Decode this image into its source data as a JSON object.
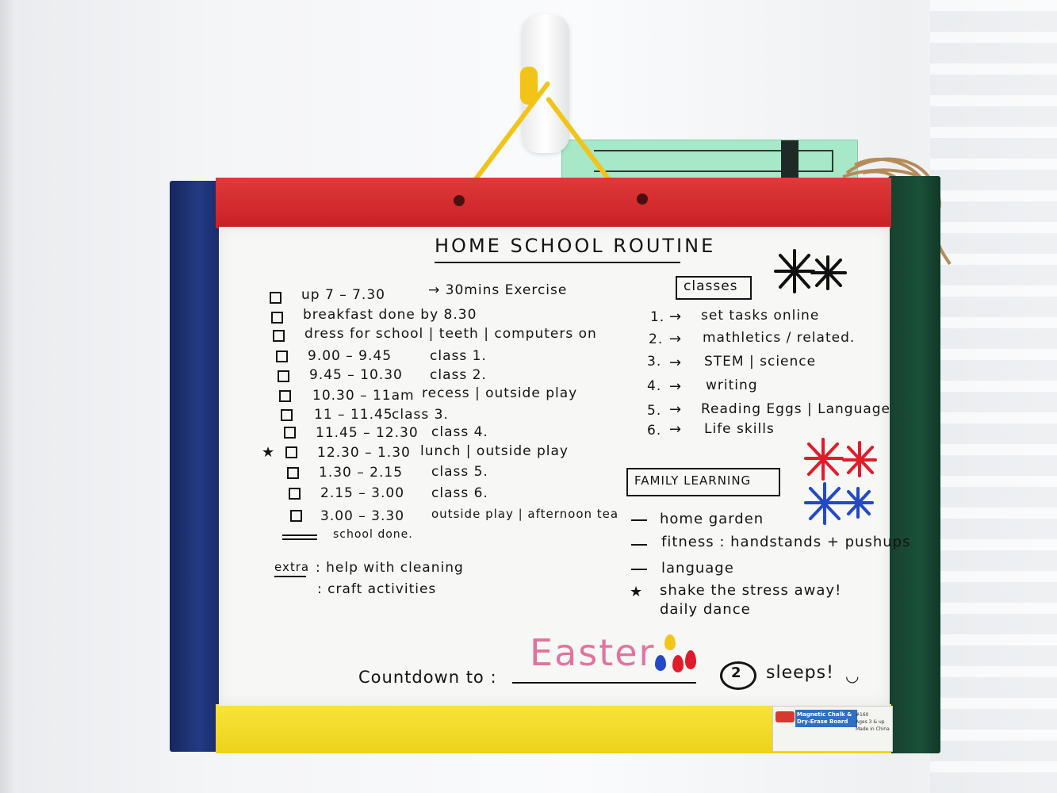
{
  "board": {
    "title": "HOME SCHOOL ROUTINE",
    "routine": [
      {
        "time": "up 7 – 7.30",
        "activity": "→ 30mins Exercise"
      },
      {
        "time": "breakfast done by 8.30",
        "activity": ""
      },
      {
        "time": "dress for school | teeth | computers on",
        "activity": ""
      },
      {
        "time": "9.00 – 9.45",
        "activity": "class 1."
      },
      {
        "time": "9.45 – 10.30",
        "activity": "class 2."
      },
      {
        "time": "10.30 – 11am",
        "activity": "recess | outside play"
      },
      {
        "time": "11 – 11.45",
        "activity": "class 3."
      },
      {
        "time": "11.45 – 12.30",
        "activity": "class 4."
      },
      {
        "time": "12.30 – 1.30",
        "activity": "lunch | outside play"
      },
      {
        "time": "1.30 – 2.15",
        "activity": "class 5."
      },
      {
        "time": "2.15 – 3.00",
        "activity": "class 6."
      },
      {
        "time": "3.00 – 3.30",
        "activity": "outside play | afternoon tea"
      }
    ],
    "school_done": "school done.",
    "extra_label": "extra",
    "extra_items": [
      ": help with cleaning",
      ": craft activities"
    ],
    "classes_heading": "classes",
    "classes": [
      {
        "num": "1.",
        "label": "set tasks online"
      },
      {
        "num": "2.",
        "label": "mathletics / related."
      },
      {
        "num": "3.",
        "label": "STEM | science"
      },
      {
        "num": "4.",
        "label": "writing"
      },
      {
        "num": "5.",
        "label": "Reading Eggs | Language"
      },
      {
        "num": "6.",
        "label": "Life skills"
      }
    ],
    "family_heading": "FAMILY LEARNING",
    "family": [
      "home garden",
      "fitness : handstands + pushups",
      "language",
      "shake the stress away! daily dance"
    ],
    "countdown_label": "Countdown to :",
    "countdown_event": "Easter",
    "sleeps_number": "2",
    "sleeps_label": "sleeps!"
  },
  "sticker": {
    "title_line1": "Magnetic Chalk &",
    "title_line2": "Dry-Erase Board",
    "meta_line1": "#160",
    "meta_line2": "Ages 3 & up",
    "meta_line3": "Made in China"
  },
  "colors": {
    "frame_red": "#d52a2e",
    "frame_blue": "#1f3478",
    "frame_green": "#184a34",
    "frame_yellow": "#f3db2a",
    "easter_pink": "#e2739f",
    "rope_yellow": "#f2c418"
  }
}
